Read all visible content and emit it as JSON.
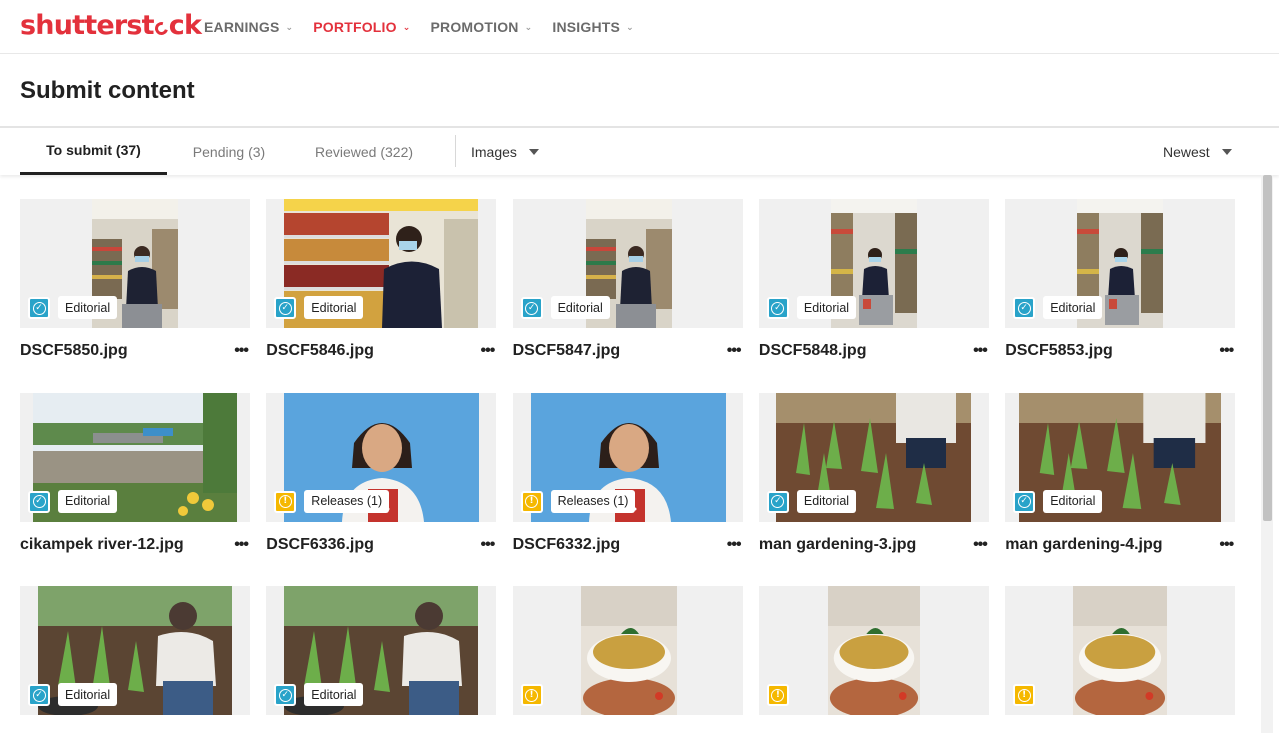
{
  "brand": {
    "logo_text_a": "shutterst",
    "logo_text_b": "ck",
    "color": "#e3313c"
  },
  "nav": {
    "items": [
      {
        "label": "EARNINGS",
        "active": false
      },
      {
        "label": "PORTFOLIO",
        "active": true
      },
      {
        "label": "PROMOTION",
        "active": false
      },
      {
        "label": "INSIGHTS",
        "active": false
      }
    ]
  },
  "page": {
    "title": "Submit content"
  },
  "tabs": [
    {
      "label": "To submit (37)",
      "active": true
    },
    {
      "label": "Pending (3)",
      "active": false
    },
    {
      "label": "Reviewed (322)",
      "active": false
    }
  ],
  "filters": {
    "media_type": "Images",
    "sort": "Newest"
  },
  "status_colors": {
    "ok": "#29a3c9",
    "warn": "#f5b800"
  },
  "items": [
    {
      "filename": "DSCF5850.jpg",
      "status": "ok",
      "badge": "Editorial",
      "scene": "store-portrait"
    },
    {
      "filename": "DSCF5846.jpg",
      "status": "ok",
      "badge": "Editorial",
      "scene": "store-shelf"
    },
    {
      "filename": "DSCF5847.jpg",
      "status": "ok",
      "badge": "Editorial",
      "scene": "store-portrait"
    },
    {
      "filename": "DSCF5848.jpg",
      "status": "ok",
      "badge": "Editorial",
      "scene": "store-aisle"
    },
    {
      "filename": "DSCF5853.jpg",
      "status": "ok",
      "badge": "Editorial",
      "scene": "store-aisle"
    },
    {
      "filename": "cikampek river-12.jpg",
      "status": "ok",
      "badge": "Editorial",
      "scene": "river"
    },
    {
      "filename": "DSCF6336.jpg",
      "status": "warn",
      "badge": "Releases (1)",
      "scene": "woman-blue"
    },
    {
      "filename": "DSCF6332.jpg",
      "status": "warn",
      "badge": "Releases (1)",
      "scene": "woman-blue"
    },
    {
      "filename": "man gardening-3.jpg",
      "status": "ok",
      "badge": "Editorial",
      "scene": "garden"
    },
    {
      "filename": "man gardening-4.jpg",
      "status": "ok",
      "badge": "Editorial",
      "scene": "garden"
    },
    {
      "filename": "",
      "status": "ok",
      "badge": "Editorial",
      "scene": "garden-man"
    },
    {
      "filename": "",
      "status": "ok",
      "badge": "Editorial",
      "scene": "garden-man"
    },
    {
      "filename": "",
      "status": "warn",
      "badge": "",
      "scene": "food-bowl"
    },
    {
      "filename": "",
      "status": "warn",
      "badge": "",
      "scene": "food-bowl"
    },
    {
      "filename": "",
      "status": "warn",
      "badge": "",
      "scene": "food-bowl"
    }
  ]
}
